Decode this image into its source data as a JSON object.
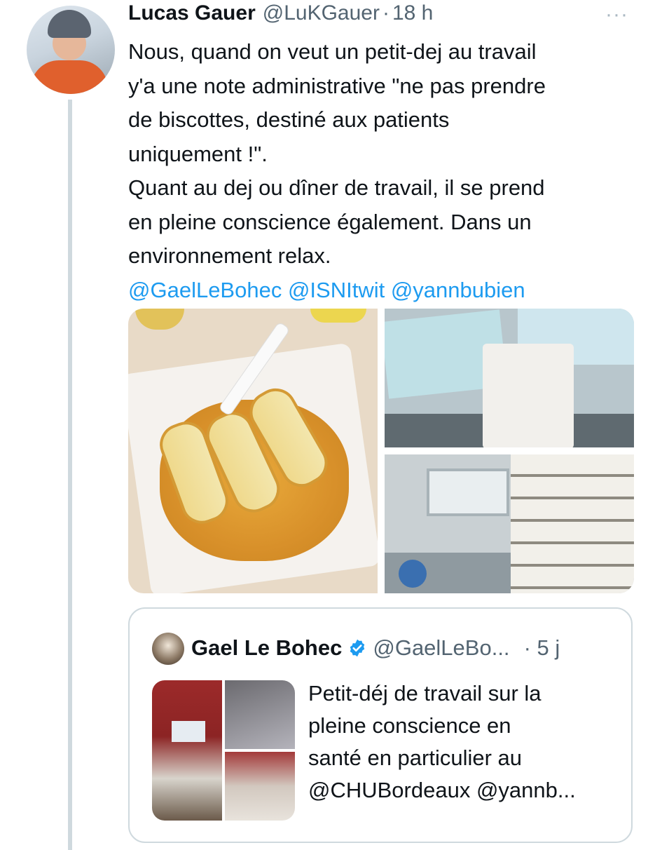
{
  "tweet": {
    "author_name": "Lucas Gauer",
    "author_handle": "@LuKGauer",
    "separator": "·",
    "time": "18 h",
    "more_icon": "···",
    "text_lines": [
      "Nous, quand on veut un petit-dej au travail",
      "y'a une note administrative \"ne pas prendre",
      "de biscottes, destiné aux patients",
      "uniquement !\".",
      "Quant au dej ou dîner de travail, il se prend",
      "en pleine conscience également. Dans un",
      "environnement relax."
    ],
    "mentions": "@GaelLeBohec @ISNItwit @yannbubien",
    "media": [
      "food-tray-photo",
      "office-folders-photo",
      "office-shelves-photo"
    ]
  },
  "quoted_tweet": {
    "author_name": "Gael Le Bohec",
    "author_handle": "@GaelLeBo...",
    "time": "· 5 j",
    "text_lines": [
      "Petit-déj de travail sur la",
      "pleine conscience en",
      "santé en particulier au",
      "@CHUBordeaux @yannb..."
    ],
    "media": [
      "meeting-room-photo",
      "conference-screen-photo",
      "meeting-people-photo"
    ]
  },
  "colors": {
    "link": "#1d9bf0",
    "secondary_text": "#536471",
    "border": "#cfd9de",
    "verified": "#1d9bf0"
  }
}
